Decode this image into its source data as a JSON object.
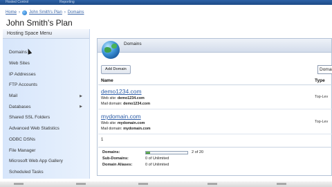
{
  "top_nav": {
    "item_1": "Hosted Control",
    "item_2": "Reporting"
  },
  "breadcrumb": {
    "home": "Home",
    "plan": "John Smith's Plan",
    "current": "Domains"
  },
  "page_title": "John Smith's Plan",
  "sidebar": {
    "header": "Hosting Space Menu",
    "items": [
      {
        "label": "Domains",
        "arrow": ""
      },
      {
        "label": "Web Sites",
        "arrow": ""
      },
      {
        "label": "IP Addresses",
        "arrow": ""
      },
      {
        "label": "FTP Accounts",
        "arrow": ""
      },
      {
        "label": "Mail",
        "arrow": "▶"
      },
      {
        "label": "Databases",
        "arrow": "▶"
      },
      {
        "label": "Shared SSL Folders",
        "arrow": ""
      },
      {
        "label": "Advanced Web Statistics",
        "arrow": ""
      },
      {
        "label": "ODBC DSNs",
        "arrow": ""
      },
      {
        "label": "File Manager",
        "arrow": ""
      },
      {
        "label": "Microsoft Web App Gallery",
        "arrow": ""
      },
      {
        "label": "Scheduled Tasks",
        "arrow": ""
      }
    ]
  },
  "panel": {
    "title": "Domains",
    "add_button": "Add Domain",
    "search_value": "Domai",
    "columns": {
      "name": "Name",
      "type": "Type"
    },
    "rows": [
      {
        "domain": "demo1234.com",
        "website_label": "Web site:",
        "website": "demo1234.com",
        "mail_label": "Mail domain:",
        "mail": "demo1234.com",
        "type": "Top-Lev"
      },
      {
        "domain": "mydomain.com",
        "website_label": "Web site:",
        "website": "mydomain.com",
        "mail_label": "Mail domain:",
        "mail": "mydomain.com",
        "type": "Top-Lev"
      }
    ],
    "pager": "1",
    "quotas": {
      "domains_label": "Domains:",
      "domains_value": "2 of 20",
      "domains_used": 2,
      "domains_total": 20,
      "subdomains_label": "Sub-Domains:",
      "subdomains_value": "0 of Unlimited",
      "aliases_label": "Domain Aliases:",
      "aliases_value": "0 of Unlimited"
    }
  },
  "colors": {
    "sidebar_bg": "#d7e6fb",
    "link": "#2e5ea8",
    "bar_fill": "#3e8f34",
    "top_bar": "#2d62a6"
  }
}
